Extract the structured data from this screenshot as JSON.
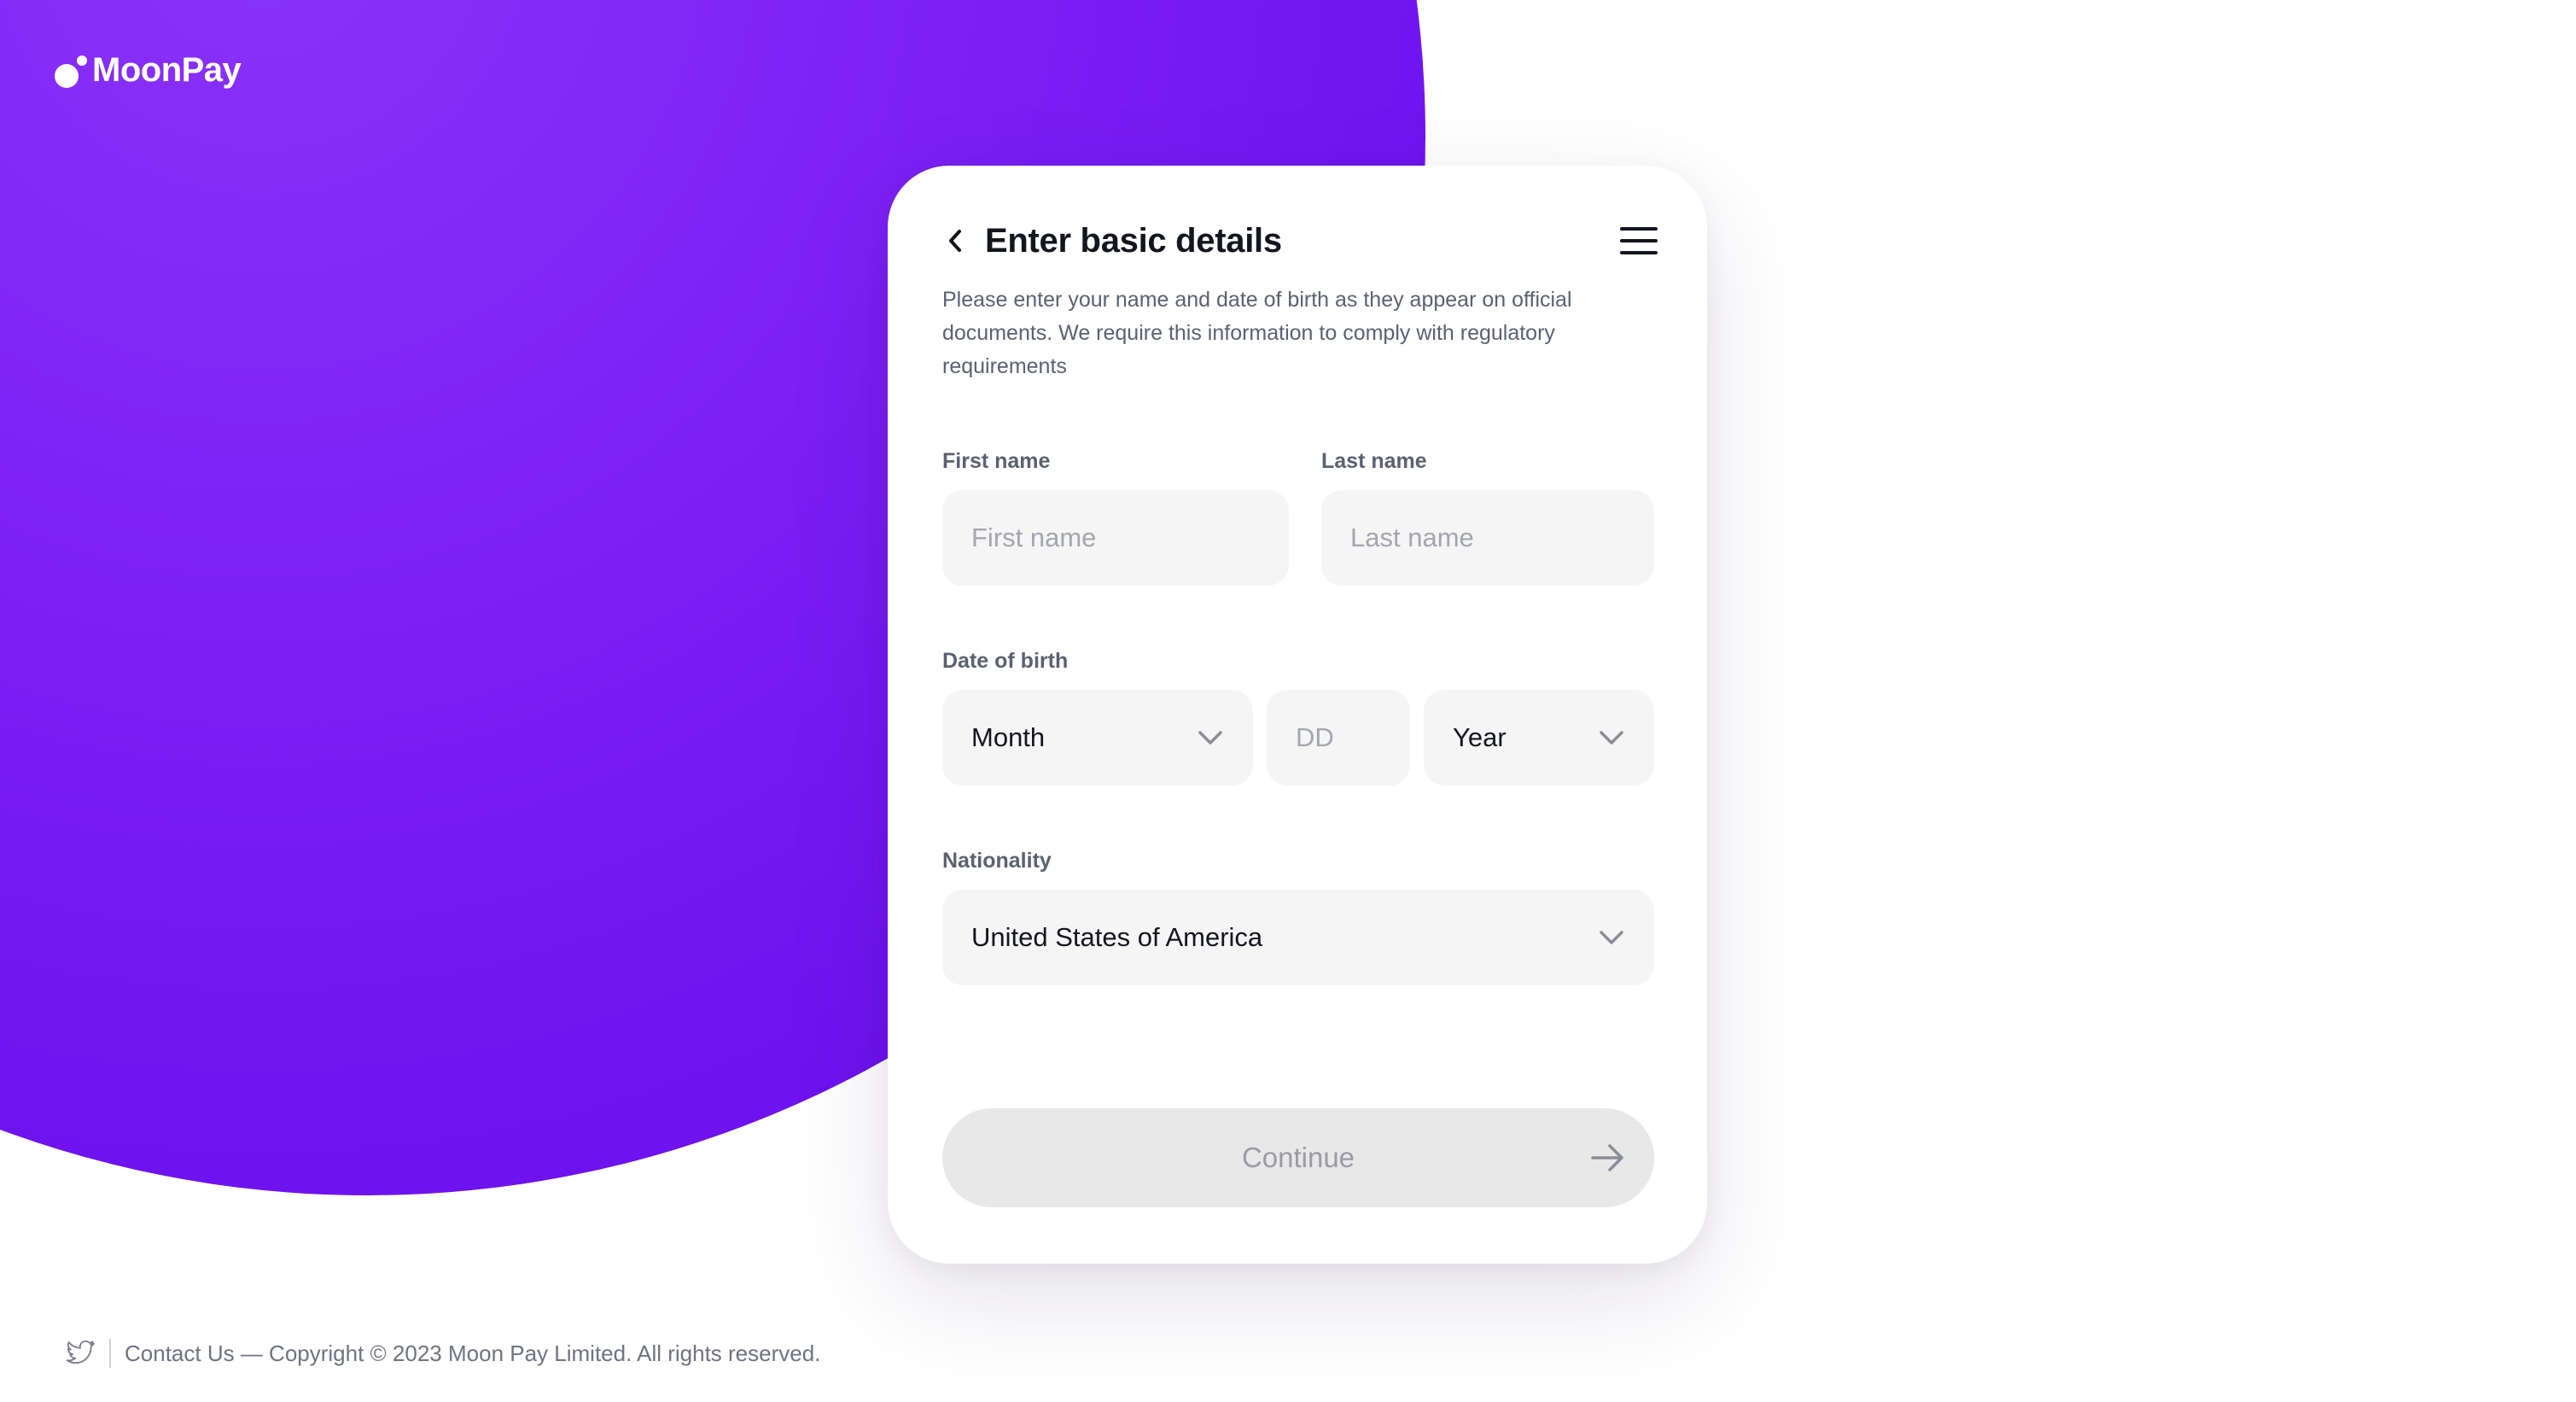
{
  "brand": {
    "name": "MoonPay",
    "primary_color": "#7b1ff5",
    "logo_icon": "moonpay-logo-icon"
  },
  "card": {
    "title": "Enter basic details",
    "description": "Please enter your name and date of birth as they appear on official documents. We require this information to comply with regulatory requirements",
    "back_icon": "chevron-left-icon",
    "menu_icon": "hamburger-menu-icon"
  },
  "form": {
    "first_name": {
      "label": "First name",
      "placeholder": "First name",
      "value": ""
    },
    "last_name": {
      "label": "Last name",
      "placeholder": "Last name",
      "value": ""
    },
    "dob": {
      "label": "Date of birth",
      "month": {
        "selected": "Month"
      },
      "day": {
        "placeholder": "DD",
        "value": ""
      },
      "year": {
        "selected": "Year"
      }
    },
    "nationality": {
      "label": "Nationality",
      "selected": "United States of America"
    },
    "continue_label": "Continue",
    "continue_icon": "arrow-right-icon",
    "continue_disabled": true
  },
  "footer": {
    "twitter_icon": "twitter-icon",
    "text": "Contact Us — Copyright © 2023 Moon Pay Limited. All rights reserved."
  }
}
